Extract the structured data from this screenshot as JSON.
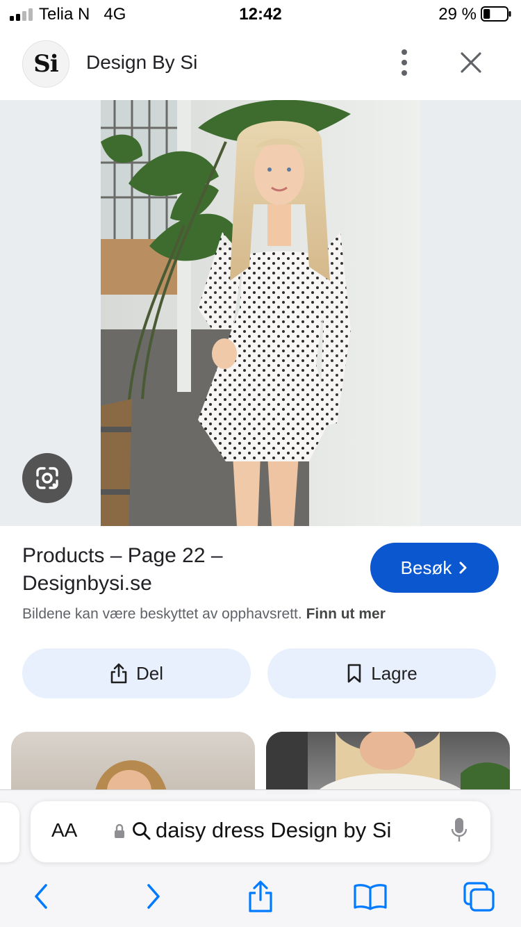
{
  "status_bar": {
    "carrier": "Telia N",
    "network": "4G",
    "time": "12:42",
    "battery_percent": "29 %",
    "battery_level": 0.29
  },
  "header": {
    "logo_text": "Si",
    "site_name": "Design By Si",
    "more_icon": "more-vertical-icon",
    "close_icon": "close-icon"
  },
  "image": {
    "lens_icon": "google-lens-icon"
  },
  "result": {
    "title_line1": "Products – Page 22 –",
    "title_line2": "Designbysi.se",
    "visit_label": "Besøk",
    "copyright_text": "Bildene kan være beskyttet av opphavsrett.",
    "learn_more": "Finn ut mer"
  },
  "actions": {
    "share_label": "Del",
    "save_label": "Lagre"
  },
  "safari": {
    "reader_label": "AA",
    "address_text": "daisy dress Design by Si",
    "colors": {
      "accent": "#007aff"
    }
  },
  "colors": {
    "visit_button": "#0b57d0",
    "action_button_bg": "#e8f0fe"
  }
}
